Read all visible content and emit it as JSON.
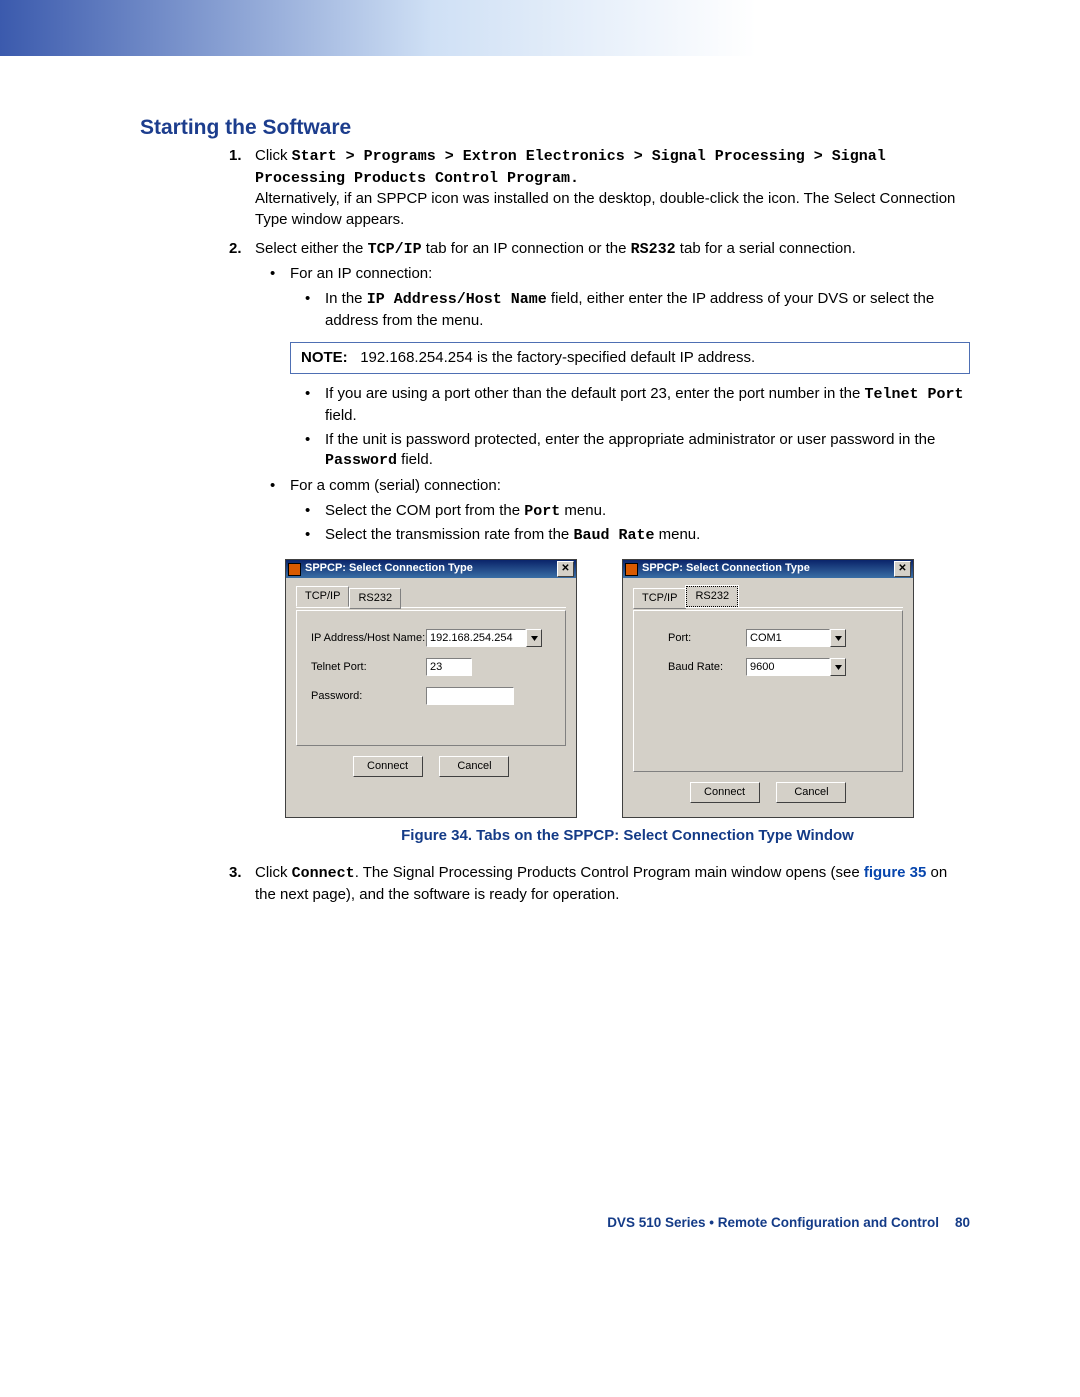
{
  "heading": "Starting the Software",
  "step1": {
    "prefix": "Click ",
    "path": "Start > Programs > Extron Electronics > Signal Processing > Signal Processing Products Control Program.",
    "alt": "Alternatively, if an SPPCP icon was installed on the desktop, double-click the icon. The Select Connection Type window appears."
  },
  "step2": {
    "t1": "Select either the ",
    "tcp": "TCP/IP",
    "t2": " tab for an IP connection or the ",
    "rs": "RS232",
    "t3": " tab for a serial connection.",
    "b_ip": "For an IP connection:",
    "ip_sub1a": "In the ",
    "ip_sub1b": "IP Address/Host Name",
    "ip_sub1c": " field, either enter the IP address of your DVS or select the address from the menu.",
    "note_lbl": "NOTE:",
    "note_txt": "192.168.254.254 is the factory-specified default IP address.",
    "ip_sub2a": "If you are using a port other than the default port 23, enter the port number in the ",
    "ip_sub2b": "Telnet Port",
    "ip_sub2c": " field.",
    "ip_sub3a": "If the unit is password protected, enter the appropriate administrator or user password in the ",
    "ip_sub3b": "Password",
    "ip_sub3c": " field.",
    "b_com": "For a comm (serial) connection:",
    "com1a": "Select the COM port from the ",
    "com1b": "Port",
    "com1c": " menu.",
    "com2a": "Select the transmission rate from the ",
    "com2b": "Baud Rate",
    "com2c": " menu."
  },
  "win": {
    "title": "SPPCP: Select Connection Type",
    "tab_tcp": "TCP/IP",
    "tab_rs": "RS232",
    "lbl_ip": "IP Address/Host Name:",
    "lbl_telnet": "Telnet Port:",
    "lbl_pwd": "Password:",
    "lbl_port": "Port:",
    "lbl_baud": "Baud Rate:",
    "val_ip": "192.168.254.254",
    "val_telnet": "23",
    "val_port": "COM1",
    "val_baud": "9600",
    "btn_connect": "Connect",
    "btn_cancel": "Cancel"
  },
  "fig_caption": "Figure 34. Tabs on the SPPCP: Select Connection Type Window",
  "step3": {
    "t1": "Click ",
    "conn": "Connect",
    "t2": ". The Signal Processing Products Control Program main window opens (see ",
    "link": "figure 35",
    "t3": " on the next page), and the software is ready for operation."
  },
  "footer": {
    "text": "DVS 510 Series • Remote Configuration and Control",
    "page": "80"
  }
}
